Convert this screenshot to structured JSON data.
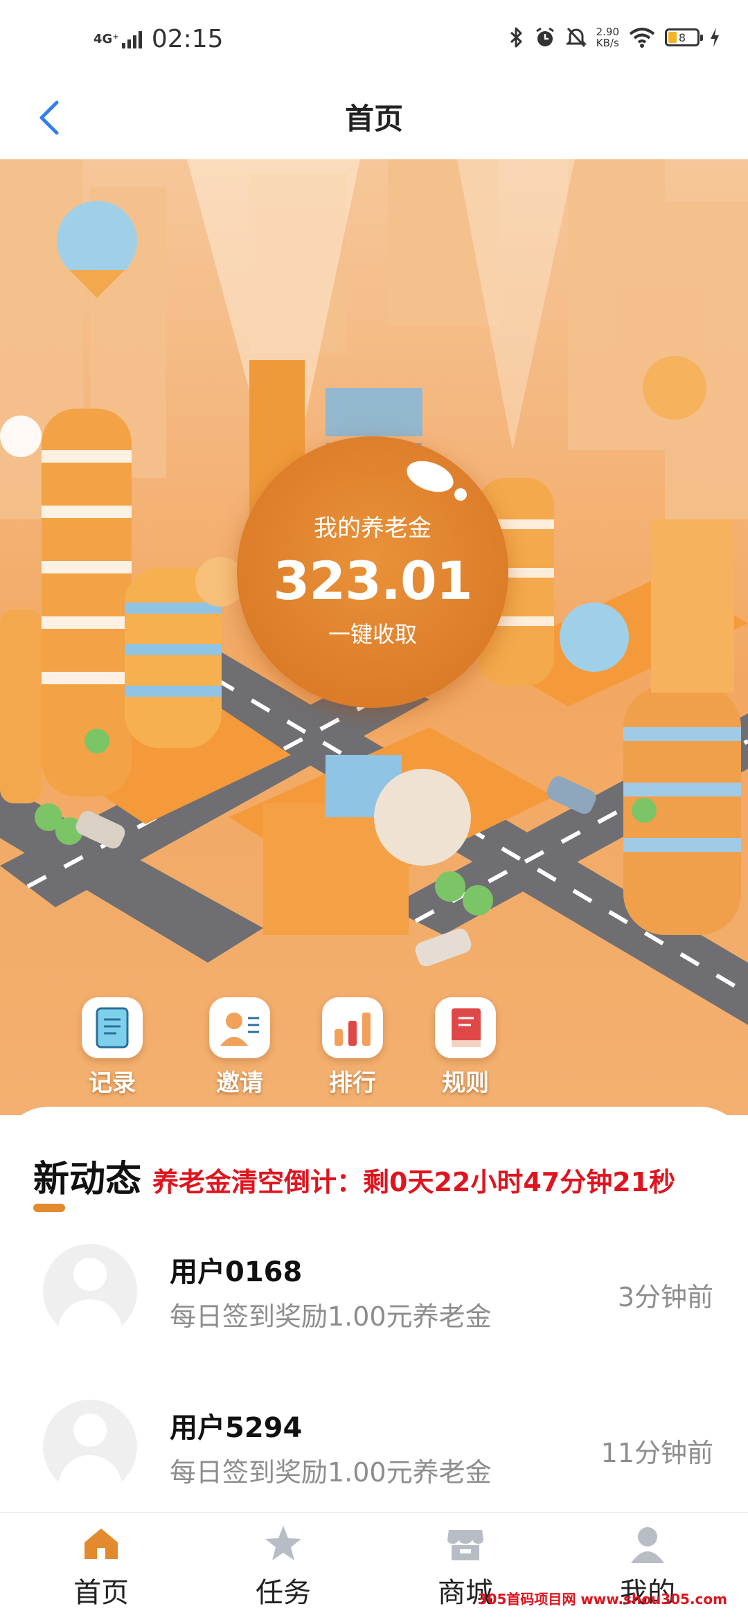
{
  "status_bar": {
    "network": "4G⁺",
    "time": "02:15",
    "speed_value": "2.90",
    "speed_unit": "KB/s",
    "battery": "8",
    "icons": [
      "bluetooth-icon",
      "alarm-icon",
      "mute-icon",
      "wifi-icon",
      "battery-icon",
      "charging-icon"
    ]
  },
  "nav": {
    "title": "首页",
    "back_icon": "chevron-left-icon"
  },
  "pension": {
    "title": "我的养老金",
    "amount": "323.01",
    "collect_label": "一键收取"
  },
  "quick_actions": [
    {
      "label": "记录",
      "icon": "record-icon"
    },
    {
      "label": "邀请",
      "icon": "invite-icon"
    },
    {
      "label": "排行",
      "icon": "ranking-icon"
    },
    {
      "label": "规则",
      "icon": "rules-book-icon"
    }
  ],
  "news": {
    "title": "新动态",
    "countdown": "养老金清空倒计：剩0天22小时47分钟21秒",
    "items": [
      {
        "name": "用户0168",
        "desc": "每日签到奖励1.00元养老金",
        "time": "3分钟前"
      },
      {
        "name": "用户5294",
        "desc": "每日签到奖励1.00元养老金",
        "time": "11分钟前"
      }
    ]
  },
  "tabs": [
    {
      "label": "首页",
      "icon": "home-icon",
      "active": true
    },
    {
      "label": "任务",
      "icon": "star-icon",
      "active": false
    },
    {
      "label": "商城",
      "icon": "store-icon",
      "active": false
    },
    {
      "label": "我的",
      "icon": "profile-icon",
      "active": false
    }
  ],
  "watermark": "305首码项目网 www.shou305.com",
  "colors": {
    "accent": "#e28a2d",
    "countdown_red": "#e0141e",
    "back_blue": "#2f7ff0",
    "circle_orange": "#de7f2b"
  }
}
